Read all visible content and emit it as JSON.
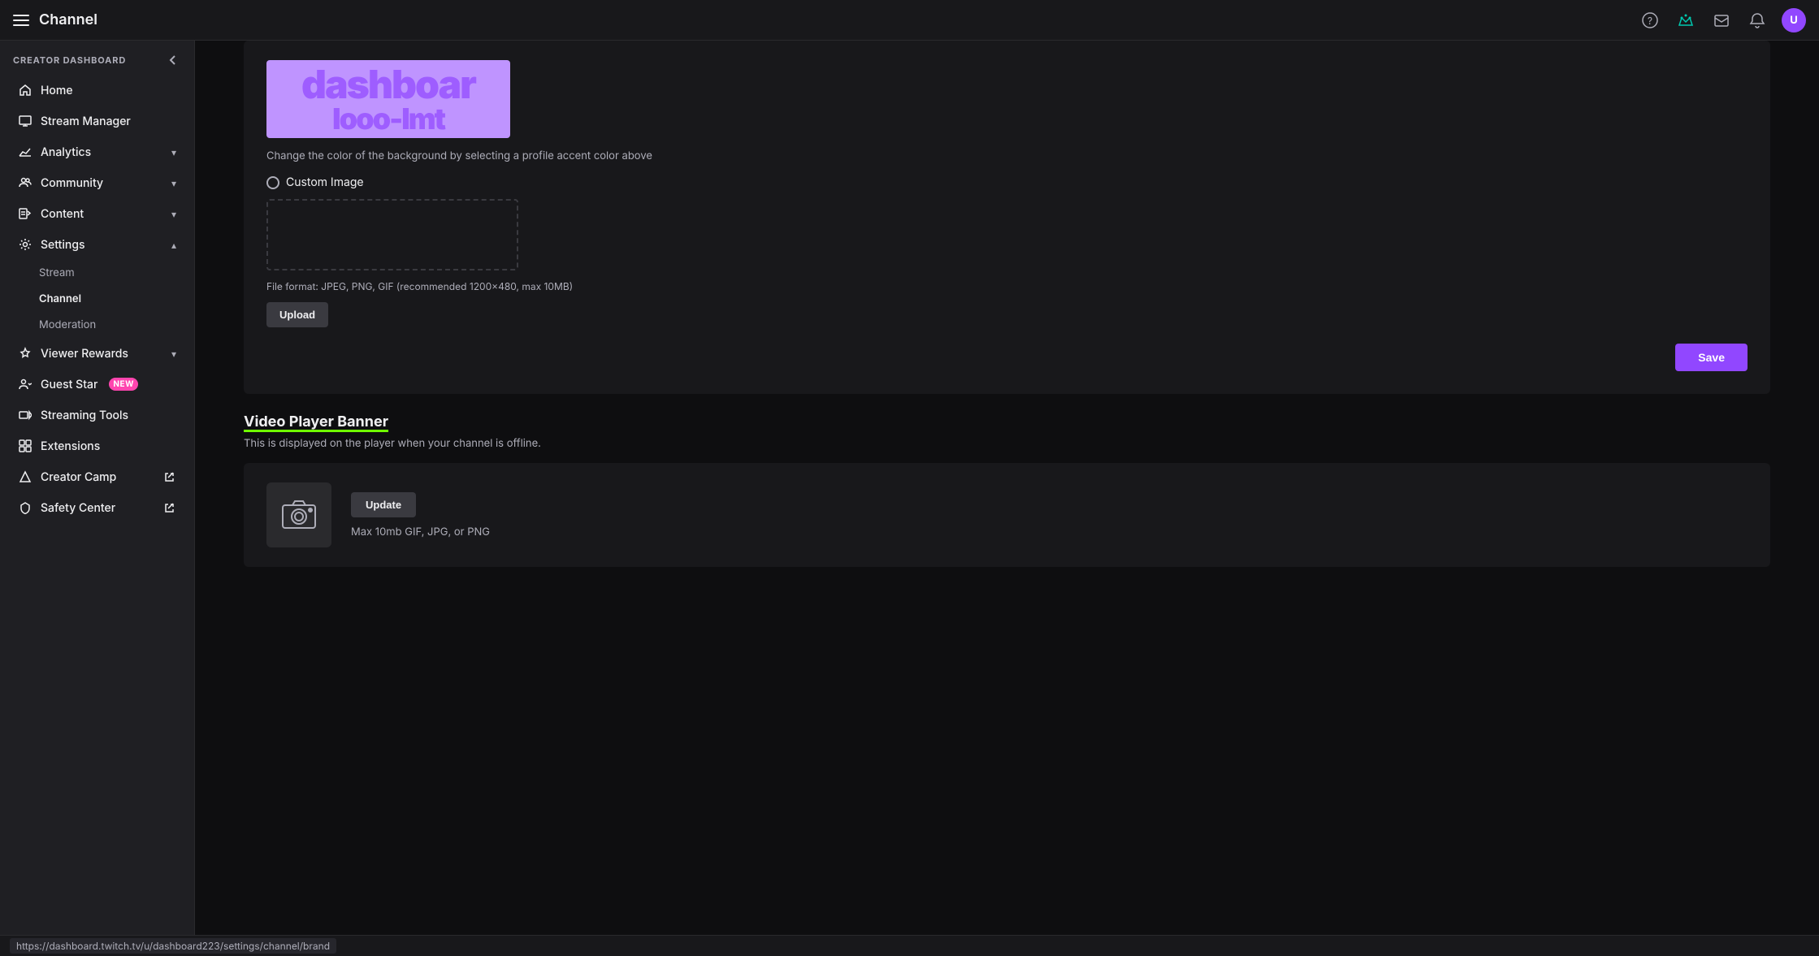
{
  "topbar": {
    "menu_label": "Menu",
    "title": "Channel",
    "icons": {
      "help": "?",
      "crown": "✦",
      "inbox": "✉",
      "notifications": "🔔"
    },
    "avatar_label": "U"
  },
  "sidebar": {
    "header_label": "CREATOR DASHBOARD",
    "collapse_label": "Collapse",
    "items": [
      {
        "id": "home",
        "label": "Home",
        "icon": "home",
        "has_chevron": false
      },
      {
        "id": "stream-manager",
        "label": "Stream Manager",
        "icon": "stream-manager",
        "has_chevron": false
      },
      {
        "id": "analytics",
        "label": "Analytics",
        "icon": "analytics",
        "has_chevron": true
      },
      {
        "id": "community",
        "label": "Community",
        "icon": "community",
        "has_chevron": true
      },
      {
        "id": "content",
        "label": "Content",
        "icon": "content",
        "has_chevron": true
      },
      {
        "id": "settings",
        "label": "Settings",
        "icon": "settings",
        "has_chevron": true,
        "expanded": true
      }
    ],
    "settings_sub": [
      {
        "id": "stream",
        "label": "Stream",
        "active": false
      },
      {
        "id": "channel",
        "label": "Channel",
        "active": true
      },
      {
        "id": "moderation",
        "label": "Moderation",
        "active": false
      }
    ],
    "bottom_items": [
      {
        "id": "viewer-rewards",
        "label": "Viewer Rewards",
        "icon": "viewer-rewards",
        "has_chevron": true
      },
      {
        "id": "guest-star",
        "label": "Guest Star",
        "icon": "guest-star",
        "badge": "NEW"
      },
      {
        "id": "streaming-tools",
        "label": "Streaming Tools",
        "icon": "streaming-tools"
      },
      {
        "id": "extensions",
        "label": "Extensions",
        "icon": "extensions"
      },
      {
        "id": "creator-camp",
        "label": "Creator Camp",
        "icon": "creator-camp",
        "external": true
      },
      {
        "id": "safety-center",
        "label": "Safety Center",
        "icon": "safety-center",
        "external": true
      }
    ]
  },
  "main": {
    "profile_banner_section": {
      "banner_preview_text": "dashboar",
      "banner_preview_text2": "looo-Imt",
      "description": "Change the color of the background by selecting a profile accent color above",
      "custom_image_label": "Custom Image",
      "upload_area_hint": "",
      "file_format_text": "File format: JPEG, PNG, GIF (recommended 1200×480, max 10MB)",
      "upload_button_label": "Upload",
      "save_button_label": "Save"
    },
    "video_player_banner_section": {
      "title": "Video Player Banner",
      "subtitle": "This is displayed on the player when your channel is offline.",
      "update_button_label": "Update",
      "update_note": "Max 10mb GIF, JPG, or PNG"
    }
  },
  "statusbar": {
    "url": "https://dashboard.twitch.tv/u/dashboard223/settings/channel/brand"
  }
}
